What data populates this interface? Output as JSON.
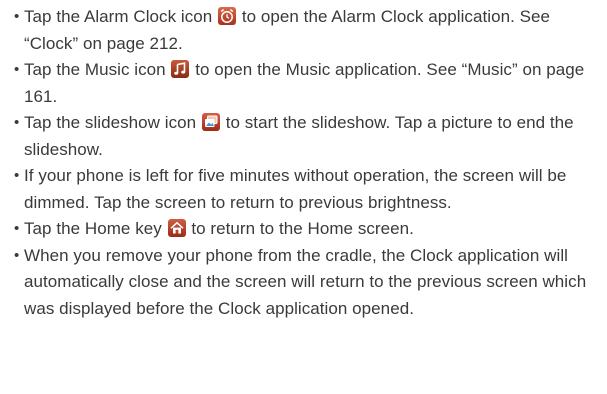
{
  "bullets": [
    {
      "before": "Tap the Alarm Clock icon ",
      "icon": "alarm-clock-icon",
      "after": " to open the Alarm Clock application. See “Clock” on page 212."
    },
    {
      "before": "Tap the Music icon ",
      "icon": "music-icon",
      "after": " to open the Music application. See “Music” on page 161."
    },
    {
      "before": "Tap the slideshow icon ",
      "icon": "slideshow-icon",
      "after": " to start the slideshow. Tap a picture to end the slideshow."
    },
    {
      "text": "If your phone is left for five minutes without operation, the screen will be dimmed. Tap the screen to return to previous brightness."
    },
    {
      "before": "Tap the Home key ",
      "icon": "home-key-icon",
      "after": " to return to the Home screen."
    },
    {
      "text": "When you remove your phone from the cradle, the Clock application will automatically close and the screen will return to the previous screen which was displayed before the Clock application opened."
    }
  ],
  "colors": {
    "text": "#3a3a3a",
    "icon_bg": "#b8422a"
  }
}
